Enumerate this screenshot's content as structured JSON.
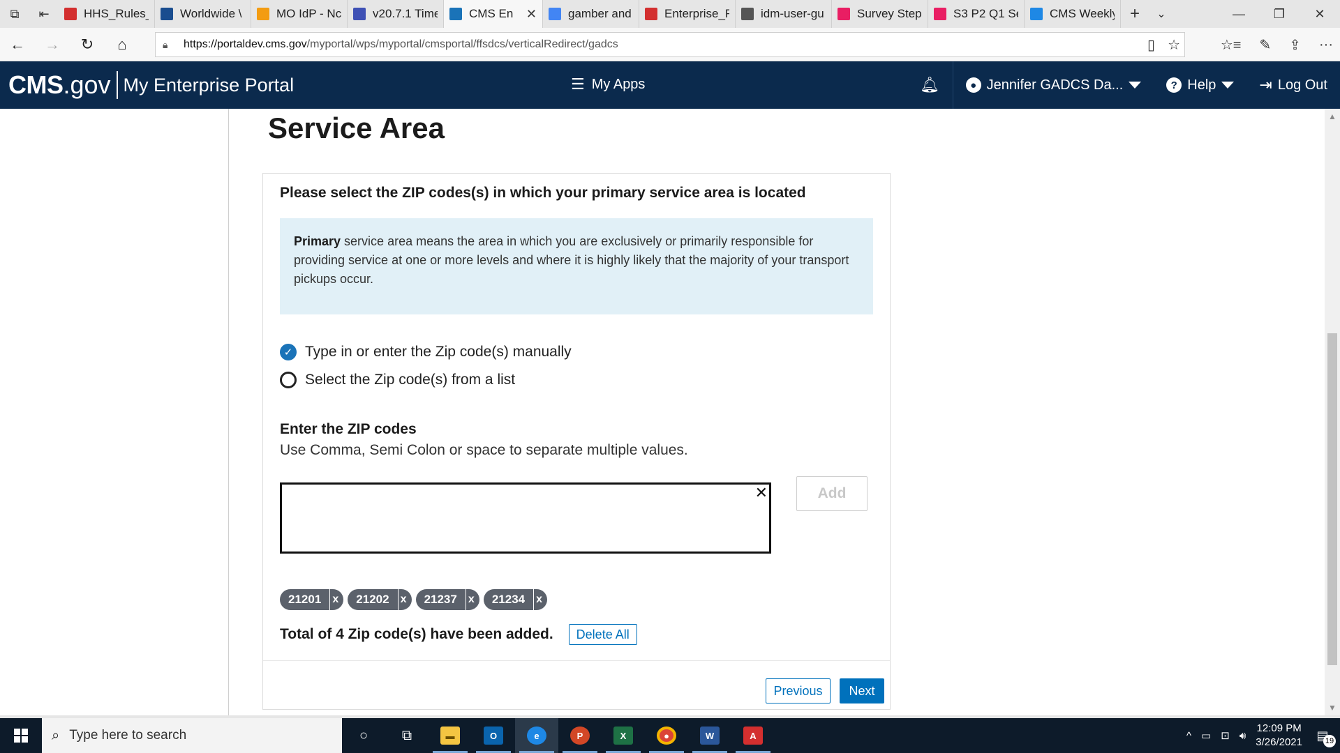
{
  "browser": {
    "tabs": [
      {
        "label": "HHS_Rules_",
        "icon": "pdf-icon",
        "color": "#d32f2f"
      },
      {
        "label": "Worldwide \\",
        "icon": "plane-icon",
        "color": "#1a4d8f"
      },
      {
        "label": "MO IdP - Nc",
        "icon": "loading-icon",
        "color": "#f39c12"
      },
      {
        "label": "v20.7.1 Time",
        "icon": "u-logo-icon",
        "color": "#3f51b5"
      },
      {
        "label": "CMS En",
        "icon": "cms-icon",
        "color": "#1a73b8",
        "active": true
      },
      {
        "label": "gamber and",
        "icon": "google-icon",
        "color": "#4285f4"
      },
      {
        "label": "Enterprise_F",
        "icon": "pdf-icon",
        "color": "#d32f2f"
      },
      {
        "label": "idm-user-gu",
        "icon": "page-icon",
        "color": "#555555"
      },
      {
        "label": "Survey Step",
        "icon": "invision-icon",
        "color": "#e91e63"
      },
      {
        "label": "S3 P2 Q1 Se",
        "icon": "invision-icon",
        "color": "#e91e63"
      },
      {
        "label": "CMS Weekly",
        "icon": "confluence-icon",
        "color": "#1e88e5"
      }
    ],
    "url": {
      "host": "https://portaldev.cms.gov",
      "path": "/myportal/wps/myportal/cmsportal/ffsdcs/verticalRedirect/gadcs"
    }
  },
  "portal": {
    "logo_cms": "CMS",
    "logo_gov": ".gov",
    "portal_name": "My Enterprise Portal",
    "my_apps": "My Apps",
    "user": "Jennifer GADCS Da...",
    "help": "Help",
    "logout": "Log Out",
    "brand_color": "#0b2a4d"
  },
  "page": {
    "title": "Service Area",
    "question": "Please select the ZIP codes(s) in which your primary service area is located",
    "info_bold": "Primary",
    "info_text": " service area means the area in which you are exclusively or primarily responsible for providing service at one or more levels and where it is highly likely that the majority of your transport pickups occur.",
    "options": [
      {
        "label": "Type in or enter the Zip code(s) manually",
        "selected": true
      },
      {
        "label": "Select the Zip code(s) from a list",
        "selected": false
      }
    ],
    "zip_label": "Enter the ZIP codes",
    "zip_hint": "Use Comma, Semi Colon or space to separate multiple values.",
    "zip_input_value": "",
    "add_label": "Add",
    "chips": [
      "21201",
      "21202",
      "21237",
      "21234"
    ],
    "chip_remove": "x",
    "total_text": "Total of 4 Zip code(s) have been added.",
    "delete_all": "Delete All",
    "previous": "Previous",
    "next": "Next",
    "accent_color": "#0071bc"
  },
  "taskbar": {
    "search_placeholder": "Type here to search",
    "time": "12:09 PM",
    "date": "3/26/2021",
    "notifications": "19"
  }
}
